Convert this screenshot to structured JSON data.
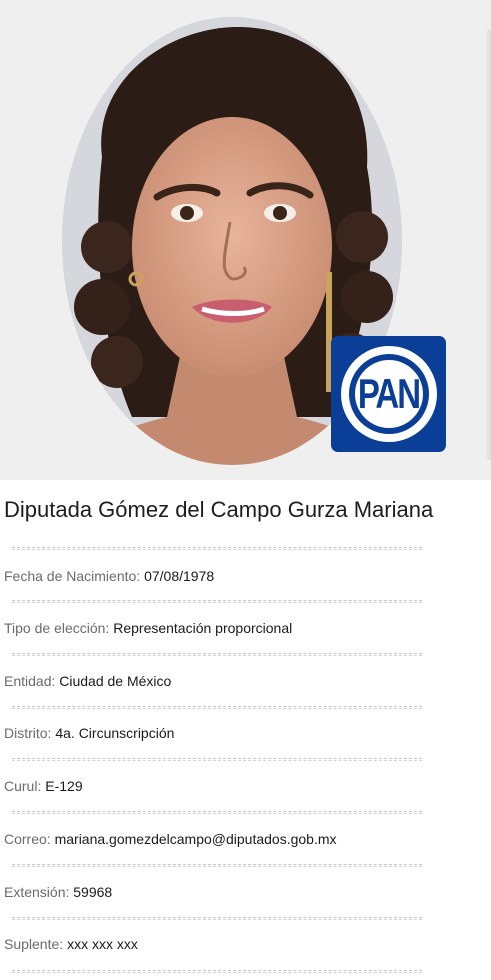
{
  "party": {
    "logo_text": "PAN",
    "color": "#0b3e96"
  },
  "profile": {
    "name": "Diputada Gómez del Campo Gurza Mariana",
    "fields": [
      {
        "label": "Fecha de Nacimiento:",
        "value": "07/08/1978"
      },
      {
        "label": "Tipo de elección:",
        "value": "Representación proporcional"
      },
      {
        "label": "Entidad:",
        "value": "Ciudad de México"
      },
      {
        "label": "Distrito:",
        "value": "4a. Circunscripción"
      },
      {
        "label": "Curul:",
        "value": "E-129"
      },
      {
        "label": "Correo:",
        "value": "mariana.gomezdelcampo@diputados.gob.mx"
      },
      {
        "label": "Extensión:",
        "value": "59968"
      },
      {
        "label": "Suplente:",
        "value": "xxx xxx xxx"
      }
    ]
  },
  "colors": {
    "photo_background": "#efefef",
    "divider": "#c7c7c7"
  }
}
